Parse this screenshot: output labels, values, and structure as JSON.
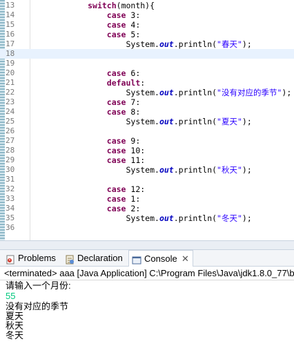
{
  "editor": {
    "lines": [
      {
        "n": "13",
        "t": "switch_month"
      },
      {
        "n": "14",
        "t": "case",
        "v": "3"
      },
      {
        "n": "15",
        "t": "case",
        "v": "4"
      },
      {
        "n": "16",
        "t": "case",
        "v": "5"
      },
      {
        "n": "17",
        "t": "print",
        "s": "\"春天\""
      },
      {
        "n": "18",
        "t": "blank"
      },
      {
        "n": "19",
        "t": "blank"
      },
      {
        "n": "20",
        "t": "case",
        "v": "6"
      },
      {
        "n": "21",
        "t": "default"
      },
      {
        "n": "22",
        "t": "print",
        "s": "\"没有对应的季节\""
      },
      {
        "n": "23",
        "t": "case",
        "v": "7"
      },
      {
        "n": "24",
        "t": "case",
        "v": "8"
      },
      {
        "n": "25",
        "t": "print",
        "s": "\"夏天\""
      },
      {
        "n": "26",
        "t": "blank"
      },
      {
        "n": "27",
        "t": "case",
        "v": "9"
      },
      {
        "n": "28",
        "t": "case",
        "v": "10"
      },
      {
        "n": "29",
        "t": "case",
        "v": "11"
      },
      {
        "n": "30",
        "t": "print",
        "s": "\"秋天\""
      },
      {
        "n": "31",
        "t": "blank"
      },
      {
        "n": "32",
        "t": "case",
        "v": "12"
      },
      {
        "n": "33",
        "t": "case",
        "v": "1"
      },
      {
        "n": "34",
        "t": "case",
        "v": "2"
      },
      {
        "n": "35",
        "t": "print",
        "s": "\"冬天\""
      },
      {
        "n": "36",
        "t": "blank"
      }
    ],
    "switch_kw": "switch",
    "switch_arg": "(month){",
    "case_kw": "case",
    "default_kw": "default",
    "sys": "System.",
    "out": "out",
    "println_open": ".println(",
    "println_close": ");"
  },
  "tabs": {
    "problems": "Problems",
    "declaration": "Declaration",
    "console": "Console",
    "close": "✕"
  },
  "console": {
    "status": "<terminated> aaa [Java Application] C:\\Program Files\\Java\\jdk1.8.0_77\\b",
    "lines": [
      "请输入一个月份:",
      "55",
      "没有对应的季节",
      "夏天",
      "秋天",
      "冬天"
    ]
  },
  "colors": {
    "keyword": "#7f0055",
    "field": "#0000c0",
    "string": "#2a00ff",
    "input_echo": "#00c87d"
  }
}
